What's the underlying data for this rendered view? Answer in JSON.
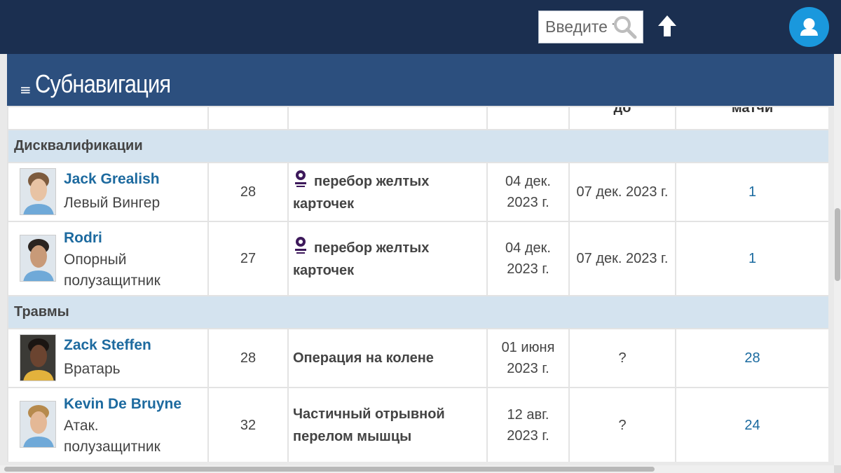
{
  "search": {
    "placeholder": "Введите текст"
  },
  "subnav": {
    "label": "Субнавигация",
    "icon": "hamburger-icon"
  },
  "table": {
    "header": [
      "",
      "",
      "",
      "",
      "до",
      "матчи"
    ],
    "groups": [
      {
        "label": "Дисквалификации",
        "players": [
          {
            "name": "Jack Grealish",
            "position": "Левый Вингер",
            "age": "28",
            "reason": "перебор желтых карточек",
            "competition_icon": "premier-league-icon",
            "from_line1": "04 дек.",
            "from_line2": "2023 г.",
            "until": "07 дек. 2023 г.",
            "matches": "1",
            "photo_colors": [
              "#7d5b3e",
              "#e8c3a4",
              "#6fa9d8"
            ]
          },
          {
            "name": "Rodri",
            "position_line1": "Опорный",
            "position_line2": "полузащитник",
            "age": "27",
            "reason": "перебор желтых карточек",
            "competition_icon": "premier-league-icon",
            "from_line1": "04 дек.",
            "from_line2": "2023 г.",
            "until": "07 дек. 2023 г.",
            "matches": "1",
            "photo_colors": [
              "#2a2420",
              "#c89a78",
              "#6fa9d8"
            ]
          }
        ]
      },
      {
        "label": "Травмы",
        "players": [
          {
            "name": "Zack Steffen",
            "position": "Вратарь",
            "age": "28",
            "reason": "Операция на колене",
            "from_line1": "01 июня",
            "from_line2": "2023 г.",
            "until": "?",
            "matches": "28",
            "photo_colors": [
              "#1b1512",
              "#6b4430",
              "#e3b23c"
            ]
          },
          {
            "name": "Kevin De Bruyne",
            "position_line1": "Атак.",
            "position_line2": "полузащитник",
            "age": "32",
            "reason_line1": "Частичный отрывной",
            "reason_line2": "перелом мышцы",
            "from_line1": "12 авг.",
            "from_line2": "2023 г.",
            "until": "?",
            "matches": "24",
            "photo_colors": [
              "#b68a4d",
              "#e4b896",
              "#6fa9d8"
            ]
          }
        ]
      }
    ]
  },
  "colors": {
    "topbar": "#1b2f50",
    "subnav": "#2c4f7e",
    "group_row": "#d4e3ef",
    "link": "#1d6a9f",
    "avatar": "#1a98dd"
  }
}
